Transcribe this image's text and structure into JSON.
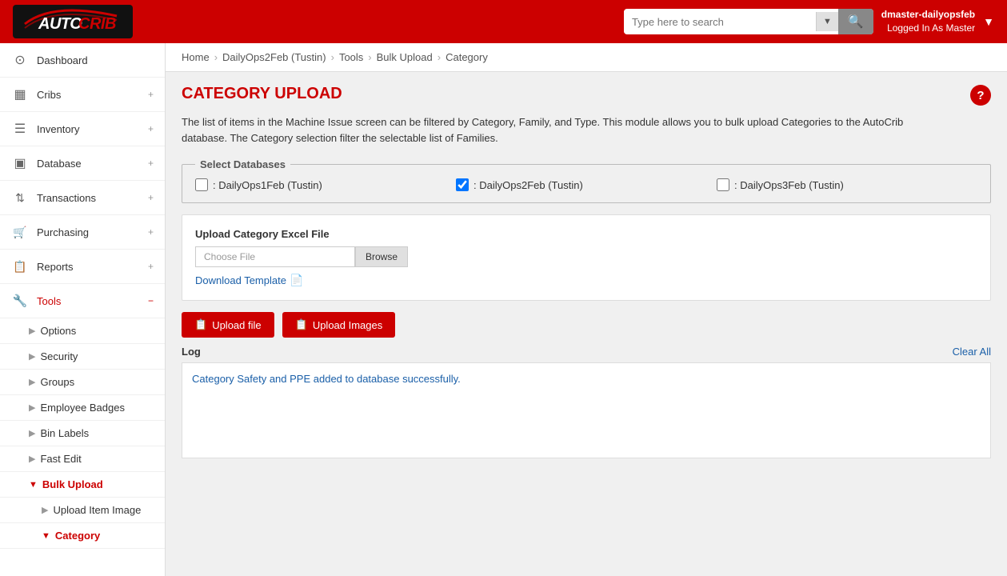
{
  "header": {
    "logo_auto": "AUTO",
    "logo_crib": "CRIB",
    "search_placeholder": "Type here to search",
    "username": "dmaster-dailyopsfeb",
    "logged_in_as": "Logged In As Master"
  },
  "sidebar": {
    "items": [
      {
        "id": "dashboard",
        "label": "Dashboard",
        "icon": "⊙",
        "active": false,
        "expandable": false
      },
      {
        "id": "cribs",
        "label": "Cribs",
        "icon": "▦",
        "active": false,
        "expandable": true
      },
      {
        "id": "inventory",
        "label": "Inventory",
        "icon": "☰",
        "active": false,
        "expandable": true
      },
      {
        "id": "database",
        "label": "Database",
        "icon": "▣",
        "active": false,
        "expandable": true
      },
      {
        "id": "transactions",
        "label": "Transactions",
        "icon": "↕",
        "active": false,
        "expandable": true
      },
      {
        "id": "purchasing",
        "label": "Purchasing",
        "icon": "🛒",
        "active": false,
        "expandable": true
      },
      {
        "id": "reports",
        "label": "Reports",
        "icon": "📋",
        "active": false,
        "expandable": true
      },
      {
        "id": "tools",
        "label": "Tools",
        "icon": "🔧",
        "active": true,
        "expandable": true,
        "expanded": true
      }
    ],
    "sub_items": [
      {
        "id": "options",
        "label": "Options",
        "active": false
      },
      {
        "id": "security",
        "label": "Security",
        "active": false
      },
      {
        "id": "groups",
        "label": "Groups",
        "active": false
      },
      {
        "id": "employee-badges",
        "label": "Employee Badges",
        "active": false
      },
      {
        "id": "bin-labels",
        "label": "Bin Labels",
        "active": false
      },
      {
        "id": "fast-edit",
        "label": "Fast Edit",
        "active": false
      },
      {
        "id": "bulk-upload",
        "label": "Bulk Upload",
        "active": true,
        "expanded": true
      },
      {
        "id": "upload-item-image",
        "label": "Upload Item Image",
        "active": false
      },
      {
        "id": "category",
        "label": "Category",
        "active": true
      }
    ]
  },
  "breadcrumb": {
    "items": [
      "Home",
      "DailyOps2Feb (Tustin)",
      "Tools",
      "Bulk Upload",
      "Category"
    ]
  },
  "page": {
    "title": "CATEGORY UPLOAD",
    "description_line1": "The list of items in the Machine Issue screen can be filtered by Category, Family, and Type. This module allows you to bulk upload Categories to the AutoCrib",
    "description_line2": "database. The Category selection filter the selectable list of Families.",
    "select_databases_legend": "Select Databases",
    "databases": [
      {
        "id": "db1",
        "label": ": DailyOps1Feb (Tustin)",
        "checked": false
      },
      {
        "id": "db2",
        "label": ": DailyOps2Feb (Tustin)",
        "checked": true
      },
      {
        "id": "db3",
        "label": ": DailyOps3Feb (Tustin)",
        "checked": false
      }
    ],
    "upload_section_label": "Upload Category Excel File",
    "file_placeholder": "Choose File",
    "browse_btn_label": "Browse",
    "download_template_label": "Download Template",
    "upload_file_btn": "Upload file",
    "upload_images_btn": "Upload Images",
    "log_label": "Log",
    "clear_all_label": "Clear All",
    "log_message": "Category Safety and PPE added to database successfully."
  }
}
